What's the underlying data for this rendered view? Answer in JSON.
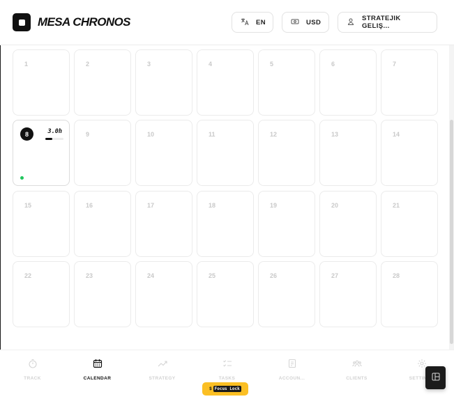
{
  "header": {
    "brand": "MESA CHRONOS",
    "language": "EN",
    "currency": "USD",
    "user": "STRATEJIK GELIŞ..."
  },
  "calendar": {
    "days": [
      "1",
      "2",
      "3",
      "4",
      "5",
      "6",
      "7",
      "8",
      "9",
      "10",
      "11",
      "12",
      "13",
      "14",
      "15",
      "16",
      "17",
      "18",
      "19",
      "20",
      "21",
      "22",
      "23",
      "24",
      "25",
      "26",
      "27",
      "28"
    ],
    "active_day": {
      "number": "8",
      "hours": "3.0h",
      "progress": 0.4,
      "status_color": "#22c55e"
    }
  },
  "nav": {
    "items": [
      {
        "label": "TRACK",
        "icon": "stopwatch-icon",
        "active": false
      },
      {
        "label": "CALENDAR",
        "icon": "calendar-icon",
        "active": true
      },
      {
        "label": "STRATEGY",
        "icon": "trend-icon",
        "active": false
      },
      {
        "label": "TASKS",
        "icon": "checklist-icon",
        "active": false
      },
      {
        "label": "ACCOUN...",
        "icon": "ledger-icon",
        "active": false
      },
      {
        "label": "CLIENTS",
        "icon": "people-icon",
        "active": false
      },
      {
        "label": "SETTINGS",
        "icon": "gear-icon",
        "active": false
      }
    ]
  },
  "focus": {
    "prefix": "$",
    "label": "Focus Lock"
  },
  "colors": {
    "accent": "#111111",
    "pill": "#fbbf24",
    "status": "#22c55e"
  }
}
